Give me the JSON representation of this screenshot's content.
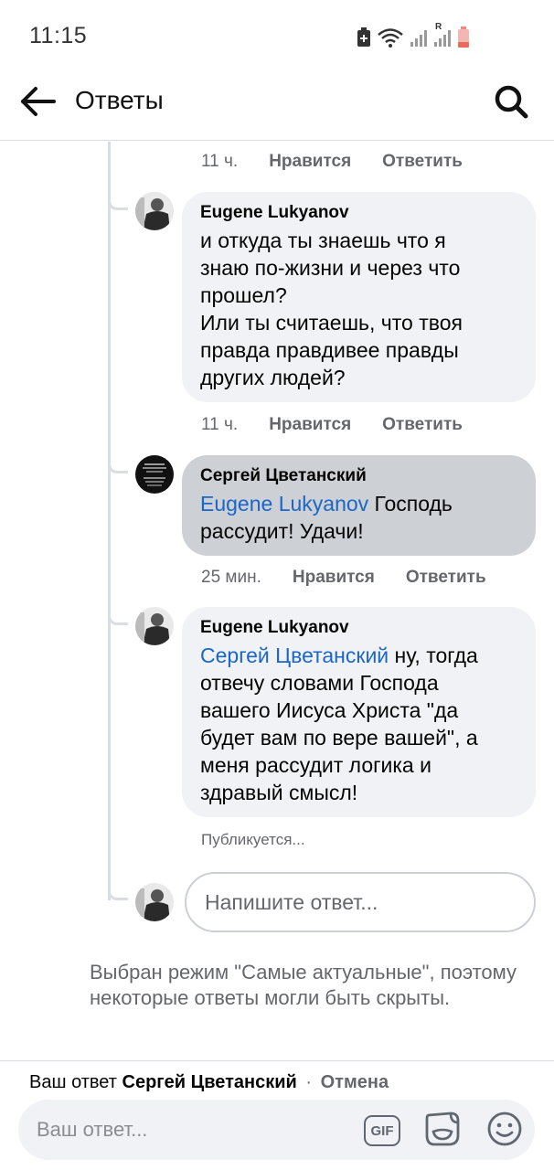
{
  "status_bar": {
    "time": "11:15",
    "signal_label": "R"
  },
  "header": {
    "title": "Ответы"
  },
  "comments": [
    {
      "id": "c0",
      "meta": {
        "time": "11 ч.",
        "like": "Нравится",
        "reply": "Ответить"
      }
    },
    {
      "id": "c1",
      "author": "Eugene Lukyanov",
      "lines": [
        "и откуда ты знаешь что я",
        "знаю по-жизни и через что",
        "прошел?",
        "Или ты считаешь, что твоя",
        "правда правдивее правды",
        "других людей?"
      ],
      "meta": {
        "time": "11 ч.",
        "like": "Нравится",
        "reply": "Ответить"
      }
    },
    {
      "id": "c2",
      "author": "Сергей Цветанский",
      "mention": "Eugene Lukyanov",
      "line1_rest": " Господь",
      "line2": "рассудит! Удачи!",
      "meta": {
        "time": "25 мин.",
        "like": "Нравится",
        "reply": "Ответить"
      }
    },
    {
      "id": "c3",
      "author": "Eugene Lukyanov",
      "mention": "Сергей Цветанский",
      "line1_rest": " ну, тогда",
      "lines": [
        "отвечу словами Господа",
        "вашего Иисуса Христа \"да",
        "будет вам по вере вашей\", а",
        "меня рассудит логика и",
        "здравый смысл!"
      ],
      "status": "Публикуется..."
    }
  ],
  "reply_box": {
    "placeholder": "Напишите ответ..."
  },
  "notice": {
    "text": "Выбран режим \"Самые актуальные\", поэтому некоторые ответы могли быть скрыты."
  },
  "bottom": {
    "reply_prefix": "Ваш ответ",
    "reply_name": "Сергей Цветанский",
    "separator": "·",
    "cancel": "Отмена",
    "composer_placeholder": "Ваш ответ...",
    "gif_label": "GIF"
  },
  "icons": [
    "arrow-left-icon",
    "search-icon",
    "gif-icon",
    "sticker-icon",
    "emoji-icon",
    "battery-icon",
    "wifi-icon",
    "signal-icon",
    "sim-icon"
  ],
  "colors": {
    "mention": "#1b66c9",
    "bubble": "#f0f2f5",
    "bubble_dark": "#cdd0d4",
    "muted": "#65676b"
  }
}
